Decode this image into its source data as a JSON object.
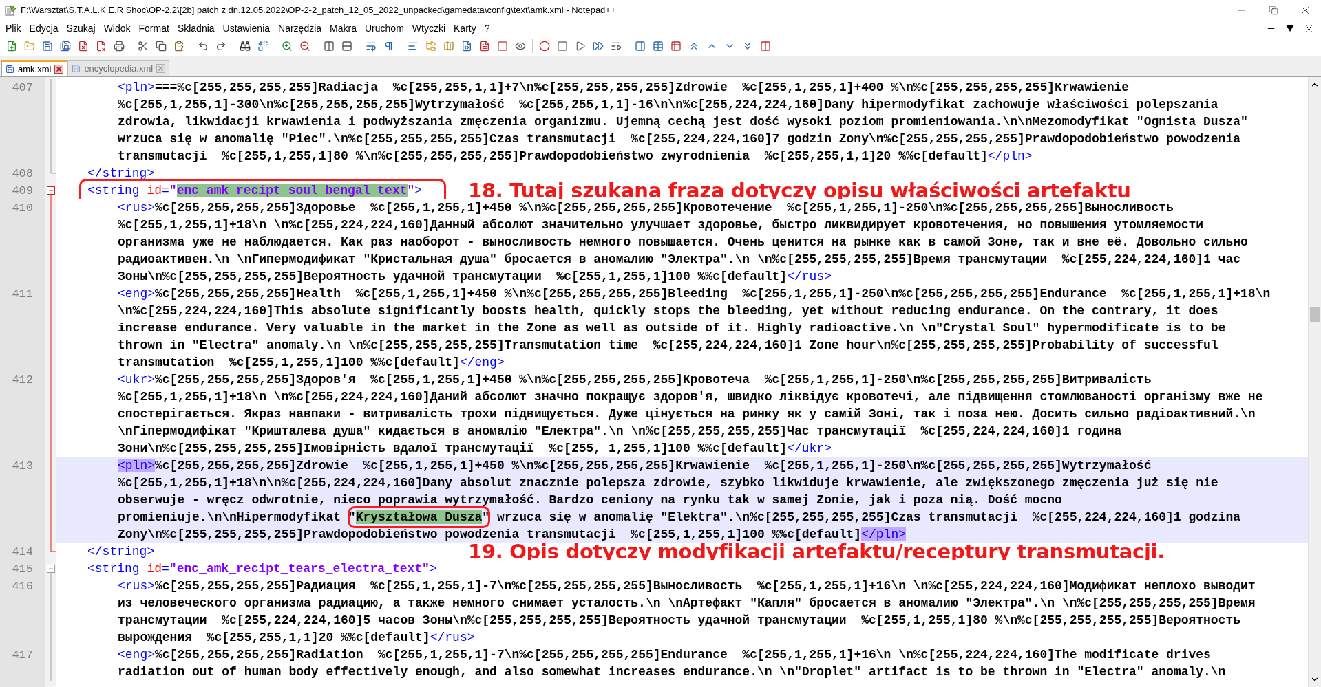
{
  "window": {
    "title": "F:\\Warsztat\\S.T.A.L.K.E.R Shoc\\OP-2.2\\[2b] patch z dn.12.05.2022\\OP-2-2_patch_12_05_2022_unpacked\\gamedata\\config\\text\\amk.xml - Notepad++"
  },
  "menu": [
    "Plik",
    "Edycja",
    "Szukaj",
    "Widok",
    "Format",
    "Składnia",
    "Ustawienia",
    "Narzędzia",
    "Makra",
    "Uruchom",
    "Wtyczki",
    "Karty",
    "?"
  ],
  "tabs": [
    {
      "label": "amk.xml",
      "selected": true
    },
    {
      "label": "encyclopedia.xml",
      "selected": false
    }
  ],
  "editor": {
    "lines": [
      {
        "number": "407",
        "kind": "content",
        "fold": {
          "kind": "body",
          "active": false
        },
        "current": false,
        "rows": [
          [
            {
              "kind": "tag",
              "text": "<pln>"
            },
            {
              "kind": "text",
              "text": "===%c[255,255,255,255]Radiacja  %c[255,255,1,1]+7\\n%c[255,255,255,255]Zdrowie  %c[255,1,255,1]+400 %\\n%c[255,255,255,255]Krwawienie"
            }
          ],
          [
            {
              "kind": "text",
              "text": "%c[255,1,255,1]-300\\n%c[255,255,255,255]Wytrzymałość  %c[255,255,1,1]-16\\n\\n%c[255,224,224,160]Dany hipermodyfikat zachowuje właściwości polepszania"
            }
          ],
          [
            {
              "kind": "text",
              "text": "zdrowia, likwidacji krwawienia i podwyższania zmęczenia organizmu. Ujemną cechą jest dość wysoki poziom promieniowania.\\n\\nMezomodyfikat \"Ognista Dusza\""
            }
          ],
          [
            {
              "kind": "text",
              "text": "wrzuca się w anomalię \"Piec\".\\n%c[255,255,255,255]Czas transmutacji  %c[255,224,224,160]7 godzin Zony\\n%c[255,255,255,255]Prawdopodobieństwo powodzenia"
            }
          ],
          [
            {
              "kind": "text",
              "text": "transmutacji  %c[255,1,255,1]80 %\\n%c[255,255,255,255]Prawdopodobieństwo zwyrodnienia  %c[255,255,1,1]20 %%c[default]"
            },
            {
              "kind": "tag",
              "text": "</pln>"
            }
          ]
        ]
      },
      {
        "number": "408",
        "kind": "element",
        "fold": {
          "kind": "end",
          "active": false
        },
        "current": false,
        "rows": [
          [
            {
              "kind": "tag",
              "text": "</string>"
            }
          ]
        ]
      },
      {
        "number": "409",
        "kind": "element",
        "fold": {
          "kind": "open",
          "active": true
        },
        "current": false,
        "annotation": "18.  Tutaj szukana fraza dotyczy opisu właściwości artefaktu",
        "rows": [
          [
            {
              "kind": "tag",
              "text": "<string "
            },
            {
              "kind": "attr",
              "text": "id"
            },
            {
              "kind": "tag",
              "text": "="
            },
            {
              "kind": "value",
              "text": "\""
            },
            {
              "kind": "value",
              "text": "enc_amk_recipt_soul_bengal_text",
              "highlight": {
                "kind": "match",
                "circled": true
              }
            },
            {
              "kind": "value",
              "text": "\""
            },
            {
              "kind": "tag",
              "text": ">"
            }
          ]
        ]
      },
      {
        "number": "410",
        "kind": "content",
        "fold": {
          "kind": "body",
          "active": true
        },
        "current": false,
        "rows": [
          [
            {
              "kind": "tag",
              "text": "<rus>"
            },
            {
              "kind": "text",
              "text": "%c[255,255,255,255]Здоровье  %c[255,1,255,1]+450 %\\n%c[255,255,255,255]Кровотечение  %c[255,1,255,1]-250\\n%c[255,255,255,255]Выносливость"
            }
          ],
          [
            {
              "kind": "text",
              "text": "%c[255,1,255,1]+18\\n \\n%c[255,224,224,160]Данный абсолют значительно улучшает здоровье, быстро ликвидирует кровотечения, но повышения утомляемости"
            }
          ],
          [
            {
              "kind": "text",
              "text": "организма уже не наблюдается. Как раз наоборот - выносливость немного повышается. Очень ценится на рынке как в самой Зоне, так и вне её. Довольно сильно"
            }
          ],
          [
            {
              "kind": "text",
              "text": "радиоактивен.\\n \\nГипермодификат \"Кристальная душа\" бросается в аномалию \"Электра\".\\n \\n%c[255,255,255,255]Время трансмутации  %c[255,224,224,160]1 час"
            }
          ],
          [
            {
              "kind": "text",
              "text": "Зоны\\n%c[255,255,255,255]Вероятность удачной трансмутации  %c[255,1,255,1]100 %%c[default]"
            },
            {
              "kind": "tag",
              "text": "</rus>"
            }
          ]
        ]
      },
      {
        "number": "411",
        "kind": "content",
        "fold": {
          "kind": "body",
          "active": true
        },
        "current": false,
        "rows": [
          [
            {
              "kind": "tag",
              "text": "<eng>"
            },
            {
              "kind": "text",
              "text": "%c[255,255,255,255]Health  %c[255,1,255,1]+450 %\\n%c[255,255,255,255]Bleeding  %c[255,1,255,1]-250\\n%c[255,255,255,255]Endurance  %c[255,1,255,1]+18\\n"
            }
          ],
          [
            {
              "kind": "text",
              "text": "\\n%c[255,224,224,160]This absolute significantly boosts health, quickly stops the bleeding, yet without reducing endurance. On the contrary, it does"
            }
          ],
          [
            {
              "kind": "text",
              "text": "increase endurance. Very valuable in the market in the Zone as well as outside of it. Highly radioactive.\\n \\n\"Crystal Soul\" hypermodificate is to be"
            }
          ],
          [
            {
              "kind": "text",
              "text": "thrown in \"Electra\" anomaly.\\n \\n%c[255,255,255,255]Transmutation time  %c[255,224,224,160]1 Zone hour\\n%c[255,255,255,255]Probability of successful"
            }
          ],
          [
            {
              "kind": "text",
              "text": "transmutation  %c[255,1,255,1]100 %%c[default]"
            },
            {
              "kind": "tag",
              "text": "</eng>"
            }
          ]
        ]
      },
      {
        "number": "412",
        "kind": "content",
        "fold": {
          "kind": "body",
          "active": true
        },
        "current": false,
        "rows": [
          [
            {
              "kind": "tag",
              "text": "<ukr>"
            },
            {
              "kind": "text",
              "text": "%c[255,255,255,255]Здоров'я  %c[255,1,255,1]+450 %\\n%c[255,255,255,255]Кровотеча  %c[255,1,255,1]-250\\n%c[255,255,255,255]Витривалість"
            }
          ],
          [
            {
              "kind": "text",
              "text": "%c[255,1,255,1]+18\\n \\n%c[255,224,224,160]Даний абсолют значно покращує здоров'я, швидко ліквідує кровотечі, але підвищення стомлюваності організму вже не"
            }
          ],
          [
            {
              "kind": "text",
              "text": "спостерігається. Якраз навпаки - витривалість трохи підвищується. Дуже цінується на ринку як у самій Зоні, так і поза нею. Досить сильно радіоактивний.\\n"
            }
          ],
          [
            {
              "kind": "text",
              "text": "\\nГіпермодифікат \"Кришталева душа\" кидається в аномалію \"Електра\".\\n \\n%c[255,255,255,255]Час трансмутації  %c[255,224,224,160]1 година"
            }
          ],
          [
            {
              "kind": "text",
              "text": "Зони\\n%c[255,255,255,255]Імовірність вдалої трансмутації  %c[255, 1,255,1]100 %%c[default]"
            },
            {
              "kind": "tag",
              "text": "</ukr>"
            }
          ]
        ]
      },
      {
        "number": "413",
        "kind": "content",
        "fold": {
          "kind": "body",
          "active": true
        },
        "current": true,
        "rows": [
          [
            {
              "kind": "tag",
              "text": "<pln>",
              "highlight": {
                "kind": "brace",
                "circled": false
              }
            },
            {
              "kind": "text",
              "text": "%c[255,255,255,255]Zdrowie  %c[255,1,255,1]+450 %\\n%c[255,255,255,255]Krwawienie  %c[255,1,255,1]-250\\n%c[255,255,255,255]Wytrzymałość"
            }
          ],
          [
            {
              "kind": "text",
              "text": "%c[255,1,255,1]+18\\n\\n%c[255,224,224,160]Dany absolut znacznie polepsza zdrowie, szybko likwiduje krwawienie, ale zwiększonego zmęczenia już się nie"
            }
          ],
          [
            {
              "kind": "text",
              "text": "obserwuje - wręcz odwrotnie, nieco poprawia wytrzymałość. Bardzo ceniony na rynku tak w samej Zonie, jak i poza nią. Dość mocno"
            }
          ],
          [
            {
              "kind": "text",
              "text": "promieniuje.\\n\\nHipermodyfikat \""
            },
            {
              "kind": "text",
              "text": "Kryształowa Dusza",
              "highlight": {
                "kind": "match",
                "circled": true
              }
            },
            {
              "kind": "text",
              "text": "\" wrzuca się w anomalię \"Elektra\".\\n%c[255,255,255,255]Czas transmutacji  %c[255,224,224,160]1 godzina"
            }
          ],
          [
            {
              "kind": "text",
              "text": "Zony\\n%c[255,255,255,255]Prawdopodobieństwo powodzenia transmutacji  %c[255,1,255,1]100 %%c[default]"
            },
            {
              "kind": "tag",
              "text": "</pln>",
              "highlight": {
                "kind": "brace",
                "circled": false
              }
            }
          ]
        ]
      },
      {
        "number": "414",
        "kind": "element",
        "fold": {
          "kind": "end",
          "active": true
        },
        "current": false,
        "annotation": "19.  Opis dotyczy modyfikacji artefaktu/receptury transmutacji.",
        "rows": [
          [
            {
              "kind": "tag",
              "text": "</string>"
            }
          ]
        ]
      },
      {
        "number": "415",
        "kind": "element",
        "fold": {
          "kind": "open",
          "active": false
        },
        "current": false,
        "rows": [
          [
            {
              "kind": "tag",
              "text": "<string "
            },
            {
              "kind": "attr",
              "text": "id"
            },
            {
              "kind": "tag",
              "text": "="
            },
            {
              "kind": "value",
              "text": "\"enc_amk_recipt_tears_electra_text\""
            },
            {
              "kind": "tag",
              "text": ">"
            }
          ]
        ]
      },
      {
        "number": "416",
        "kind": "content",
        "fold": {
          "kind": "body",
          "active": false
        },
        "current": false,
        "rows": [
          [
            {
              "kind": "tag",
              "text": "<rus>"
            },
            {
              "kind": "text",
              "text": "%c[255,255,255,255]Радиация  %c[255,1,255,1]-7\\n%c[255,255,255,255]Выносливость  %c[255,1,255,1]+16\\n \\n%c[255,224,224,160]Модификат неплохо выводит"
            }
          ],
          [
            {
              "kind": "text",
              "text": "из человеческого организма радиацию, а также немного снимает усталость.\\n \\nАртефакт \"Капля\" бросается в аномалию \"Электра\".\\n \\n%c[255,255,255,255]Время"
            }
          ],
          [
            {
              "kind": "text",
              "text": "трансмутации  %c[255,224,224,160]5 часов Зоны\\n%c[255,255,255,255]Вероятность удачной трансмутации  %c[255,1,255,1]80 %\\n%c[255,255,255,255]Вероятность"
            }
          ],
          [
            {
              "kind": "text",
              "text": "вырождения  %c[255,255,1,1]20 %%c[default]"
            },
            {
              "kind": "tag",
              "text": "</rus>"
            }
          ]
        ]
      },
      {
        "number": "417",
        "kind": "content",
        "fold": {
          "kind": "body",
          "active": false
        },
        "current": false,
        "rows": [
          [
            {
              "kind": "tag",
              "text": "<eng>"
            },
            {
              "kind": "text",
              "text": "%c[255,255,255,255]Radiation  %c[255,1,255,1]-7\\n%c[255,255,255,255]Endurance  %c[255,1,255,1]+16\\n \\n%c[255,224,224,160]The modificate drives"
            }
          ],
          [
            {
              "kind": "text",
              "text": "radiation out of human body effectively enough, and also somewhat increases endurance.\\n \\n\"Droplet\" artifact is to be thrown in \"Electra\" anomaly.\\n"
            }
          ]
        ]
      }
    ]
  }
}
